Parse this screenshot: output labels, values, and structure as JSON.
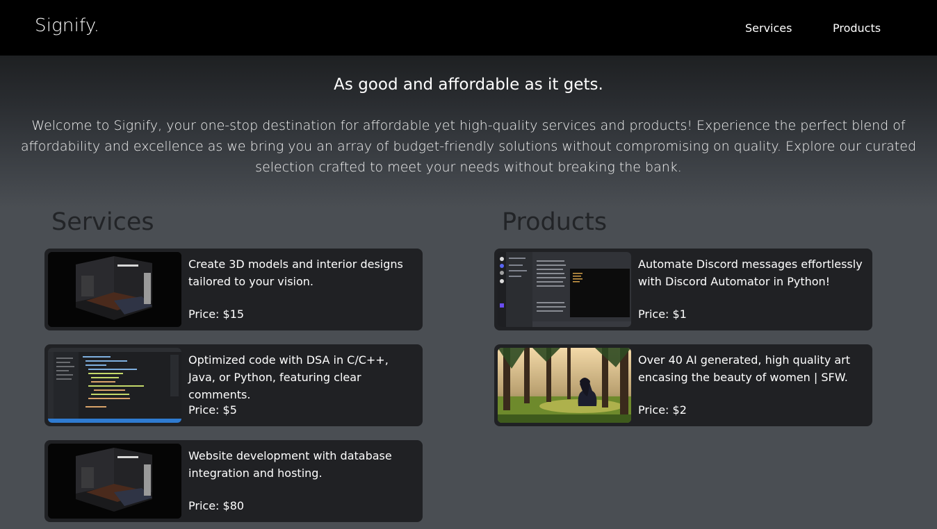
{
  "header": {
    "logo": "Signify.",
    "nav": {
      "services": "Services",
      "products": "Products"
    }
  },
  "hero": {
    "tagline": "As good and affordable as it gets.",
    "intro": "Welcome to Signify, your one-stop destination for affordable yet high-quality services and products! Experience the perfect blend of affordability and excellence as we bring you an array of budget-friendly solutions without compromising on quality. Explore our curated selection crafted to meet your needs without breaking the bank."
  },
  "services": {
    "title": "Services",
    "items": [
      {
        "description": "Create 3D models and interior designs tailored to your vision.",
        "price": "Price: $15",
        "thumb_icon": "3d-room-render"
      },
      {
        "description": "Optimized code with DSA in C/C++, Java, or Python, featuring clear comments.",
        "price": "Price: $5",
        "thumb_icon": "code-editor-screenshot"
      },
      {
        "description": "Website development with database integration and hosting.",
        "price": "Price: $80",
        "thumb_icon": "3d-room-render"
      }
    ]
  },
  "products": {
    "title": "Products",
    "items": [
      {
        "description": "Automate Discord messages effortlessly with Discord Automator in Python!",
        "price": "Price: $1",
        "thumb_icon": "discord-app-screenshot"
      },
      {
        "description": "Over 40 AI generated, high quality art encasing the beauty of women | SFW.",
        "price": "Price: $2",
        "thumb_icon": "anime-forest-art"
      }
    ]
  },
  "colors": {
    "header_bg": "#000000",
    "page_bg": "#4a4e53",
    "card_bg": "#202124",
    "section_title": "#222427"
  }
}
